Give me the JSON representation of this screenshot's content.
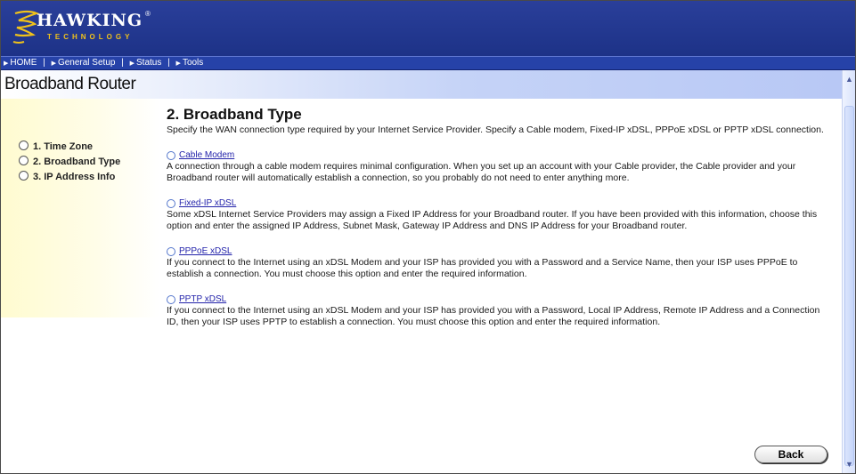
{
  "brand": {
    "name": "HAWKING",
    "registered": "®",
    "tagline": "TECHNOLOGY",
    "gold": "#f0c21a"
  },
  "nav": {
    "items": [
      "HOME",
      "General Setup",
      "Status",
      "Tools"
    ],
    "separator": "|"
  },
  "page": {
    "title": "Broadband Router"
  },
  "sidebar": {
    "items": [
      "1. Time Zone",
      "2. Broadband Type",
      "3. IP Address Info"
    ]
  },
  "content": {
    "title": "2. Broadband Type",
    "description": "Specify the WAN connection type required by your Internet Service Provider. Specify a Cable modem, Fixed-IP xDSL, PPPoE xDSL or PPTP xDSL connection.",
    "options": [
      {
        "label": "Cable Modem",
        "description": "A connection through a cable modem requires minimal configuration. When you set up an account with your Cable provider, the Cable provider and your Broadband router will automatically establish a connection, so you probably do not need to enter anything more."
      },
      {
        "label": "Fixed-IP xDSL",
        "description": "Some xDSL Internet Service Providers may assign a Fixed IP Address for your Broadband router. If you have been provided with this information, choose this option and enter the assigned IP Address, Subnet Mask, Gateway IP Address and DNS IP Address for your Broadband router."
      },
      {
        "label": "PPPoE xDSL",
        "description": "If you connect to the Internet using an xDSL Modem and your ISP has provided you with a Password and a Service Name, then your ISP uses PPPoE to establish a connection. You must choose this option and enter the required information."
      },
      {
        "label": "PPTP xDSL",
        "description": "If you connect to the Internet using an xDSL Modem and your ISP has provided you with a Password, Local IP Address, Remote IP Address and a Connection ID, then your ISP uses PPTP to establish a connection. You must choose this option and enter the required information."
      }
    ]
  },
  "buttons": {
    "back": "Back"
  },
  "colors": {
    "header": "#1d3287",
    "navbar": "#2642a8",
    "link": "#2222aa"
  },
  "icons": {
    "logo": "hawk-logo-icon",
    "scroll_up": "scroll-up-arrow-icon",
    "scroll_down": "scroll-down-arrow-icon"
  }
}
